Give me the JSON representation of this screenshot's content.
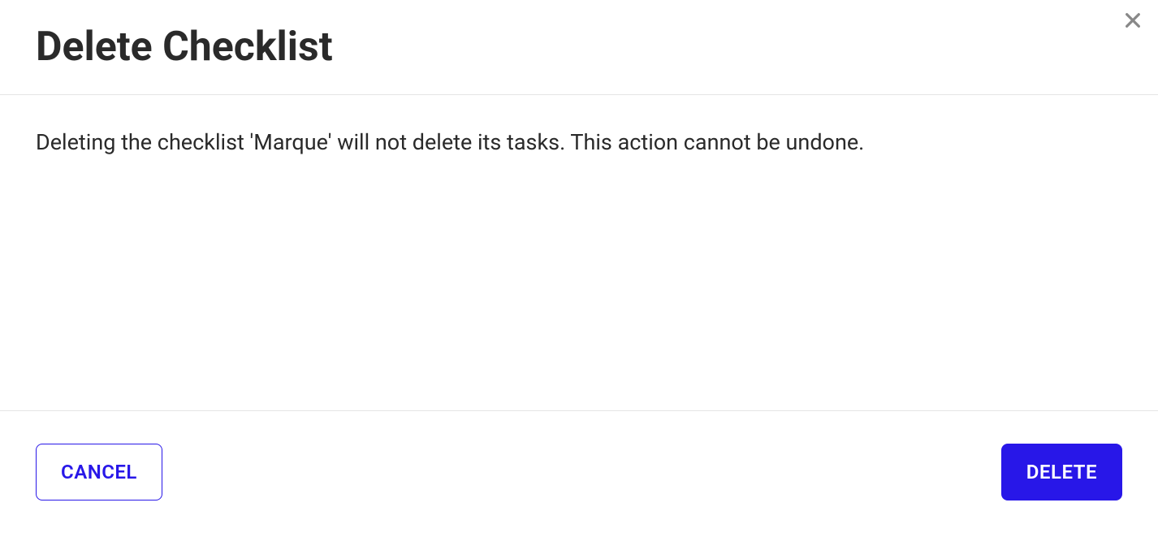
{
  "dialog": {
    "title": "Delete Checklist",
    "message": "Deleting the checklist 'Marque' will not delete its tasks. This action cannot be undone.",
    "buttons": {
      "cancel": "CANCEL",
      "delete": "DELETE"
    }
  },
  "colors": {
    "primary": "#2817e8",
    "text": "#2a2a2a",
    "border": "#e5e5e5",
    "close_icon": "#888888"
  }
}
